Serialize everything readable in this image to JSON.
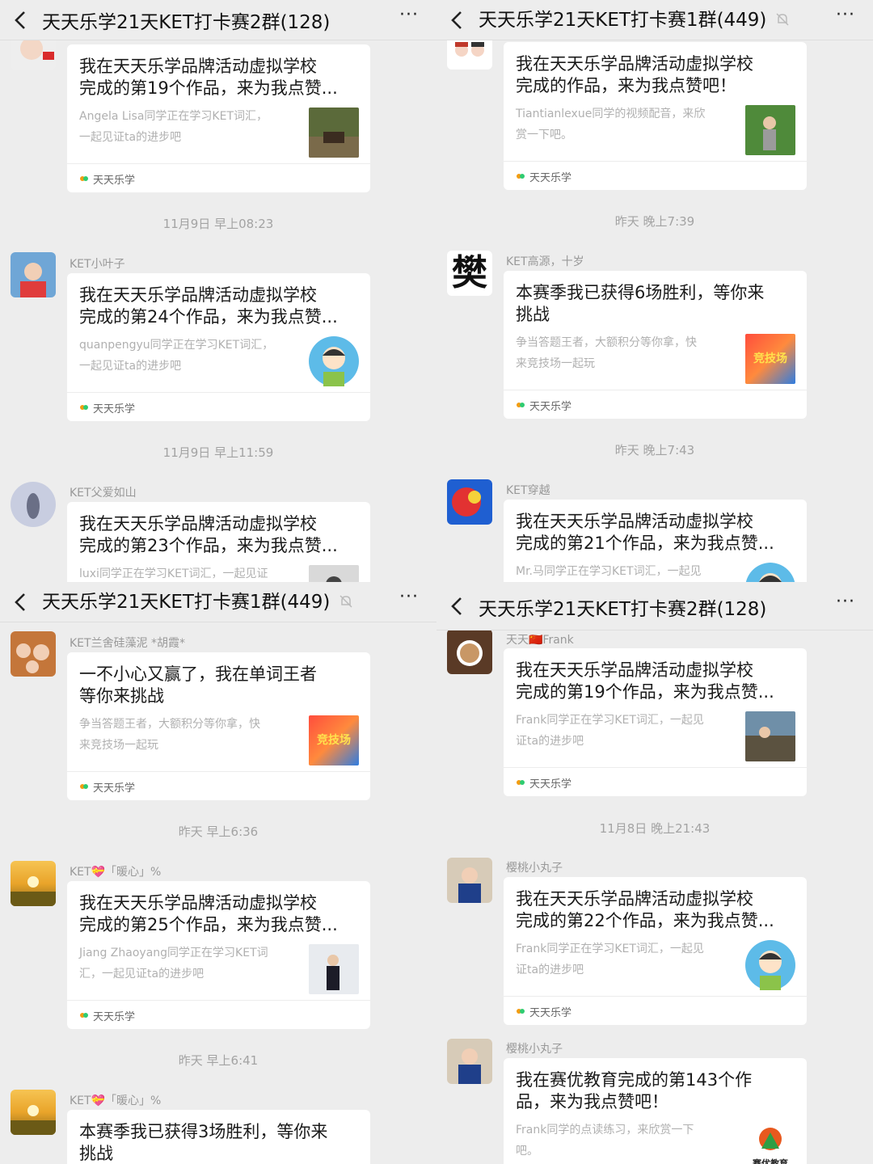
{
  "colors": {
    "background": "#ededed",
    "card": "#ffffff",
    "title_text": "#1a1a1a",
    "meta_text": "#999999"
  },
  "panels": [
    {
      "header": {
        "title": "天天乐学21天KET打卡赛2群(128)",
        "muted": false,
        "more": "···"
      },
      "items": [
        {
          "sender": "",
          "title_line1": "我在天天乐学品牌活动虚拟学校",
          "title_line2": "完成的第19个作品，来为我点赞...",
          "desc1": "Angela Lisa同学正在学习KET词汇，",
          "desc2": "一起见证ta的进步吧",
          "app": "天天乐学",
          "thumb_icon": "field-photo-icon"
        },
        {
          "time": "11月9日 早上08:23"
        },
        {
          "sender": "KET小叶子",
          "title_line1": "我在天天乐学品牌活动虚拟学校",
          "title_line2": "完成的第24个作品，来为我点赞...",
          "desc1": "quanpengyu同学正在学习KET词汇，",
          "desc2": "一起见证ta的进步吧",
          "app": "天天乐学",
          "thumb_icon": "child-avatar-icon"
        },
        {
          "time": "11月9日 早上11:59"
        },
        {
          "sender": "KET父爱如山",
          "title_line1": "我在天天乐学品牌活动虚拟学校",
          "title_line2": "完成的第23个作品，来为我点赞...",
          "desc1": "luxi同学正在学习KET词汇，一起见证",
          "desc2": ""
        }
      ]
    },
    {
      "header": {
        "title": "天天乐学21天KET打卡赛1群(449)",
        "muted": true,
        "more": "···"
      },
      "items": [
        {
          "sender": "",
          "title_line1": "我在天天乐学品牌活动虚拟学校",
          "title_line2": "完成的作品，来为我点赞吧！",
          "desc1": "Tiantianlexue同学的视频配音，来欣",
          "desc2": "赏一下吧。",
          "app": "天天乐学",
          "thumb_icon": "garden-photo-icon"
        },
        {
          "time": "昨天 晚上7:39"
        },
        {
          "sender": "KET高源，十岁",
          "title_line1": "本赛季我已获得6场胜利，等你来",
          "title_line2": "挑战",
          "desc1": "争当答题王者，大额积分等你拿，快",
          "desc2": "来竞技场一起玩",
          "app": "天天乐学",
          "thumb_icon": "arena-badge-icon",
          "thumb_label": "竞技场"
        },
        {
          "time": "昨天 晚上7:43"
        },
        {
          "sender": "KET穿越",
          "title_line1": "我在天天乐学品牌活动虚拟学校",
          "title_line2": "完成的第21个作品，来为我点赞...",
          "desc1": "Mr.马同学正在学习KET词汇，一起见",
          "desc2": ""
        }
      ],
      "avatar_text": "樊"
    },
    {
      "header": {
        "title": "天天乐学21天KET打卡赛1群(449)",
        "muted": true,
        "more": "···"
      },
      "items": [
        {
          "sender": "KET兰舍硅藻泥 *胡霞*",
          "title_line1": "一不小心又赢了，我在单词王者",
          "title_line2": "等你来挑战",
          "desc1": "争当答题王者，大额积分等你拿，快",
          "desc2": "来竞技场一起玩",
          "app": "天天乐学",
          "thumb_icon": "arena-badge-icon",
          "thumb_label": "竞技场"
        },
        {
          "time": "昨天 早上6:36"
        },
        {
          "sender": "KET💝「暖心」%",
          "title_line1": "我在天天乐学品牌活动虚拟学校",
          "title_line2": "完成的第25个作品，来为我点赞...",
          "desc1": "Jiang Zhaoyang同学正在学习KET词",
          "desc2": "汇，一起见证ta的进步吧",
          "app": "天天乐学",
          "thumb_icon": "snow-photo-icon"
        },
        {
          "time": "昨天 早上6:41"
        },
        {
          "sender": "KET💝「暖心」%",
          "title_line1": "本赛季我已获得3场胜利，等你来",
          "title_line2": "挑战"
        }
      ]
    },
    {
      "header": {
        "title": "天天乐学21天KET打卡赛2群(128)",
        "muted": false,
        "more": "···"
      },
      "items": [
        {
          "sender": "天天🇨🇳Frank",
          "title_line1": "我在天天乐学品牌活动虚拟学校",
          "title_line2": "完成的第19个作品，来为我点赞...",
          "desc1": "Frank同学正在学习KET词汇，一起见",
          "desc2": "证ta的进步吧",
          "app": "天天乐学",
          "thumb_icon": "outdoor-photo-icon"
        },
        {
          "time": "11月8日 晚上21:43"
        },
        {
          "sender": "樱桃小丸子",
          "title_line1": "我在天天乐学品牌活动虚拟学校",
          "title_line2": "完成的第22个作品，来为我点赞...",
          "desc1": "Frank同学正在学习KET词汇，一起见",
          "desc2": "证ta的进步吧",
          "app": "天天乐学",
          "thumb_icon": "child-avatar-icon"
        },
        {
          "sender": "樱桃小丸子",
          "title_line1": "我在赛优教育完成的第143个作",
          "title_line2": "品，来为我点赞吧！",
          "desc1": "Frank同学的点读练习，来欣赏一下",
          "desc2": "吧。",
          "thumb_icon": "saiyou-logo-icon",
          "thumb_label": "赛优教育"
        }
      ]
    }
  ]
}
